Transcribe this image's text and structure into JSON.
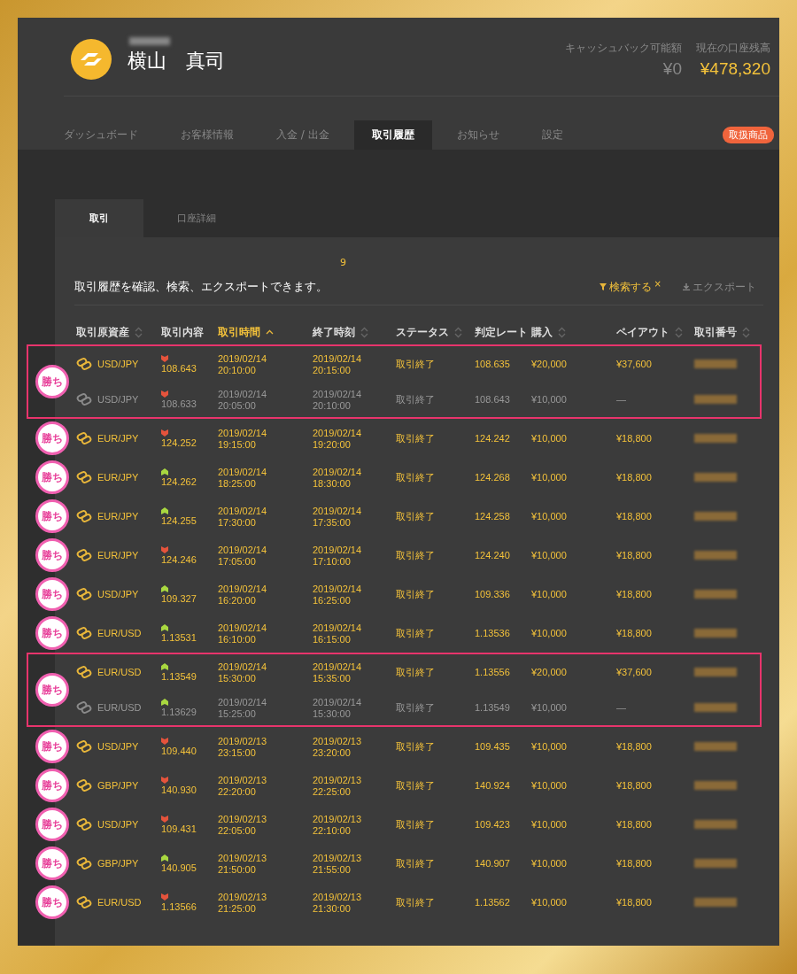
{
  "account": {
    "name": "横山　真司",
    "cashback": {
      "label": "キャッシュバック可能額",
      "value": "¥0"
    },
    "balance": {
      "label": "現在の口座残高",
      "value": "¥478,320"
    }
  },
  "nav": [
    {
      "label": "ダッシュボード",
      "selected": false
    },
    {
      "label": "お客様情報",
      "selected": false
    },
    {
      "label": "入金 / 出金",
      "selected": false
    },
    {
      "label": "取引履歴",
      "selected": true
    },
    {
      "label": "お知らせ",
      "selected": false
    },
    {
      "label": "設定",
      "selected": false
    }
  ],
  "products_badge": "取扱商品",
  "subtabs": [
    {
      "label": "取引",
      "selected": true
    },
    {
      "label": "口座詳細",
      "selected": false
    }
  ],
  "count": "9",
  "description": "取引履歴を確認、検索、エクスポートできます。",
  "actions": [
    {
      "kind": "search",
      "label": "検索する",
      "clear": "×"
    },
    {
      "kind": "export",
      "label": "エクスポート"
    }
  ],
  "columns": [
    {
      "label": "取引原資産",
      "sortable": true,
      "selected": false
    },
    {
      "label": "取引内容",
      "sortable": false,
      "selected": false
    },
    {
      "label": "取引時間",
      "sortable": true,
      "selected": true
    },
    {
      "label": "終了時刻",
      "sortable": true,
      "selected": false
    },
    {
      "label": "ステータス",
      "sortable": true,
      "selected": false
    },
    {
      "label": "判定レート",
      "sortable": false,
      "selected": false
    },
    {
      "label": "購入",
      "sortable": true,
      "selected": false
    },
    {
      "label": "ペイアウト",
      "sortable": true,
      "selected": false
    },
    {
      "label": "取引番号",
      "sortable": true,
      "selected": false
    }
  ],
  "groups": [
    {
      "badge": "勝ち",
      "highlighted": true,
      "rows": [
        {
          "pair": "USD/JPY",
          "rising": false,
          "open_rate": "108.643",
          "start_date": "2019/02/14",
          "start_time": "20:10:00",
          "end_date": "2019/02/14",
          "end_time": "20:15:00",
          "status": "取引終了",
          "judge_rate": "108.635",
          "purchase": "¥20,000",
          "payout": "¥37,600",
          "active": true
        },
        {
          "pair": "USD/JPY",
          "rising": false,
          "open_rate": "108.633",
          "start_date": "2019/02/14",
          "start_time": "20:05:00",
          "end_date": "2019/02/14",
          "end_time": "20:10:00",
          "status": "取引終了",
          "judge_rate": "108.643",
          "purchase": "¥10,000",
          "payout": "—",
          "active": false
        }
      ]
    },
    {
      "badge": "勝ち",
      "highlighted": false,
      "rows": [
        {
          "pair": "EUR/JPY",
          "rising": false,
          "open_rate": "124.252",
          "start_date": "2019/02/14",
          "start_time": "19:15:00",
          "end_date": "2019/02/14",
          "end_time": "19:20:00",
          "status": "取引終了",
          "judge_rate": "124.242",
          "purchase": "¥10,000",
          "payout": "¥18,800",
          "active": true
        }
      ]
    },
    {
      "badge": "勝ち",
      "highlighted": false,
      "rows": [
        {
          "pair": "EUR/JPY",
          "rising": true,
          "open_rate": "124.262",
          "start_date": "2019/02/14",
          "start_time": "18:25:00",
          "end_date": "2019/02/14",
          "end_time": "18:30:00",
          "status": "取引終了",
          "judge_rate": "124.268",
          "purchase": "¥10,000",
          "payout": "¥18,800",
          "active": true
        }
      ]
    },
    {
      "badge": "勝ち",
      "highlighted": false,
      "rows": [
        {
          "pair": "EUR/JPY",
          "rising": true,
          "open_rate": "124.255",
          "start_date": "2019/02/14",
          "start_time": "17:30:00",
          "end_date": "2019/02/14",
          "end_time": "17:35:00",
          "status": "取引終了",
          "judge_rate": "124.258",
          "purchase": "¥10,000",
          "payout": "¥18,800",
          "active": true
        }
      ]
    },
    {
      "badge": "勝ち",
      "highlighted": false,
      "rows": [
        {
          "pair": "EUR/JPY",
          "rising": false,
          "open_rate": "124.246",
          "start_date": "2019/02/14",
          "start_time": "17:05:00",
          "end_date": "2019/02/14",
          "end_time": "17:10:00",
          "status": "取引終了",
          "judge_rate": "124.240",
          "purchase": "¥10,000",
          "payout": "¥18,800",
          "active": true
        }
      ]
    },
    {
      "badge": "勝ち",
      "highlighted": false,
      "rows": [
        {
          "pair": "USD/JPY",
          "rising": true,
          "open_rate": "109.327",
          "start_date": "2019/02/14",
          "start_time": "16:20:00",
          "end_date": "2019/02/14",
          "end_time": "16:25:00",
          "status": "取引終了",
          "judge_rate": "109.336",
          "purchase": "¥10,000",
          "payout": "¥18,800",
          "active": true
        }
      ]
    },
    {
      "badge": "勝ち",
      "highlighted": false,
      "rows": [
        {
          "pair": "EUR/USD",
          "rising": true,
          "open_rate": "1.13531",
          "start_date": "2019/02/14",
          "start_time": "16:10:00",
          "end_date": "2019/02/14",
          "end_time": "16:15:00",
          "status": "取引終了",
          "judge_rate": "1.13536",
          "purchase": "¥10,000",
          "payout": "¥18,800",
          "active": true
        }
      ]
    },
    {
      "badge": "勝ち",
      "highlighted": true,
      "rows": [
        {
          "pair": "EUR/USD",
          "rising": true,
          "open_rate": "1.13549",
          "start_date": "2019/02/14",
          "start_time": "15:30:00",
          "end_date": "2019/02/14",
          "end_time": "15:35:00",
          "status": "取引終了",
          "judge_rate": "1.13556",
          "purchase": "¥20,000",
          "payout": "¥37,600",
          "active": true
        },
        {
          "pair": "EUR/USD",
          "rising": true,
          "open_rate": "1.13629",
          "start_date": "2019/02/14",
          "start_time": "15:25:00",
          "end_date": "2019/02/14",
          "end_time": "15:30:00",
          "status": "取引終了",
          "judge_rate": "1.13549",
          "purchase": "¥10,000",
          "payout": "—",
          "active": false
        }
      ]
    },
    {
      "badge": "勝ち",
      "highlighted": false,
      "rows": [
        {
          "pair": "USD/JPY",
          "rising": false,
          "open_rate": "109.440",
          "start_date": "2019/02/13",
          "start_time": "23:15:00",
          "end_date": "2019/02/13",
          "end_time": "23:20:00",
          "status": "取引終了",
          "judge_rate": "109.435",
          "purchase": "¥10,000",
          "payout": "¥18,800",
          "active": true
        }
      ]
    },
    {
      "badge": "勝ち",
      "highlighted": false,
      "rows": [
        {
          "pair": "GBP/JPY",
          "rising": false,
          "open_rate": "140.930",
          "start_date": "2019/02/13",
          "start_time": "22:20:00",
          "end_date": "2019/02/13",
          "end_time": "22:25:00",
          "status": "取引終了",
          "judge_rate": "140.924",
          "purchase": "¥10,000",
          "payout": "¥18,800",
          "active": true
        }
      ]
    },
    {
      "badge": "勝ち",
      "highlighted": false,
      "rows": [
        {
          "pair": "USD/JPY",
          "rising": false,
          "open_rate": "109.431",
          "start_date": "2019/02/13",
          "start_time": "22:05:00",
          "end_date": "2019/02/13",
          "end_time": "22:10:00",
          "status": "取引終了",
          "judge_rate": "109.423",
          "purchase": "¥10,000",
          "payout": "¥18,800",
          "active": true
        }
      ]
    },
    {
      "badge": "勝ち",
      "highlighted": false,
      "rows": [
        {
          "pair": "GBP/JPY",
          "rising": true,
          "open_rate": "140.905",
          "start_date": "2019/02/13",
          "start_time": "21:50:00",
          "end_date": "2019/02/13",
          "end_time": "21:55:00",
          "status": "取引終了",
          "judge_rate": "140.907",
          "purchase": "¥10,000",
          "payout": "¥18,800",
          "active": true
        }
      ]
    },
    {
      "badge": "勝ち",
      "highlighted": false,
      "rows": [
        {
          "pair": "EUR/USD",
          "rising": false,
          "open_rate": "1.13566",
          "start_date": "2019/02/13",
          "start_time": "21:25:00",
          "end_date": "2019/02/13",
          "end_time": "21:30:00",
          "status": "取引終了",
          "judge_rate": "1.13562",
          "purchase": "¥10,000",
          "payout": "¥18,800",
          "active": true
        }
      ]
    }
  ]
}
